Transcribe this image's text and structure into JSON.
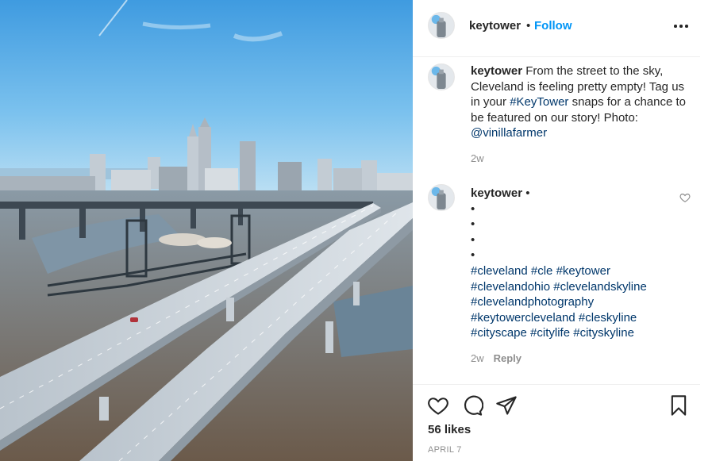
{
  "photo": {
    "alt": "Aerial view of empty highway bridges leading to the Cleveland skyline"
  },
  "header": {
    "username": "keytower",
    "separator": "•",
    "follow_label": "Follow",
    "more_icon": "more-horizontal-icon"
  },
  "caption": {
    "username": "keytower",
    "text_before": " From the street to the sky, Cleveland is feeling pretty empty! Tag us in your ",
    "hashtag": "#KeyTower",
    "text_middle": " snaps for a chance to be featured on our story! Photo: ",
    "mention": "@vinillafarmer",
    "time": "2w"
  },
  "comment": {
    "username": "keytower",
    "trailing_dot": " •",
    "bullets": [
      "•",
      "•",
      "•",
      "•"
    ],
    "hashtags": "#cleveland #cle #keytower #clevelandohio #clevelandskyline #clevelandphotography #keytowercleveland #cleskyline #cityscape #citylife #cityskyline",
    "time": "2w",
    "reply_label": "Reply"
  },
  "actions": {
    "icons": [
      "heart-icon",
      "comment-icon",
      "share-icon",
      "bookmark-icon"
    ],
    "likes": "56 likes",
    "date": "APRIL 7"
  },
  "colors": {
    "accent": "#0095f6",
    "hashtag": "#00376b",
    "muted": "#8e8e8e",
    "text": "#262626"
  }
}
